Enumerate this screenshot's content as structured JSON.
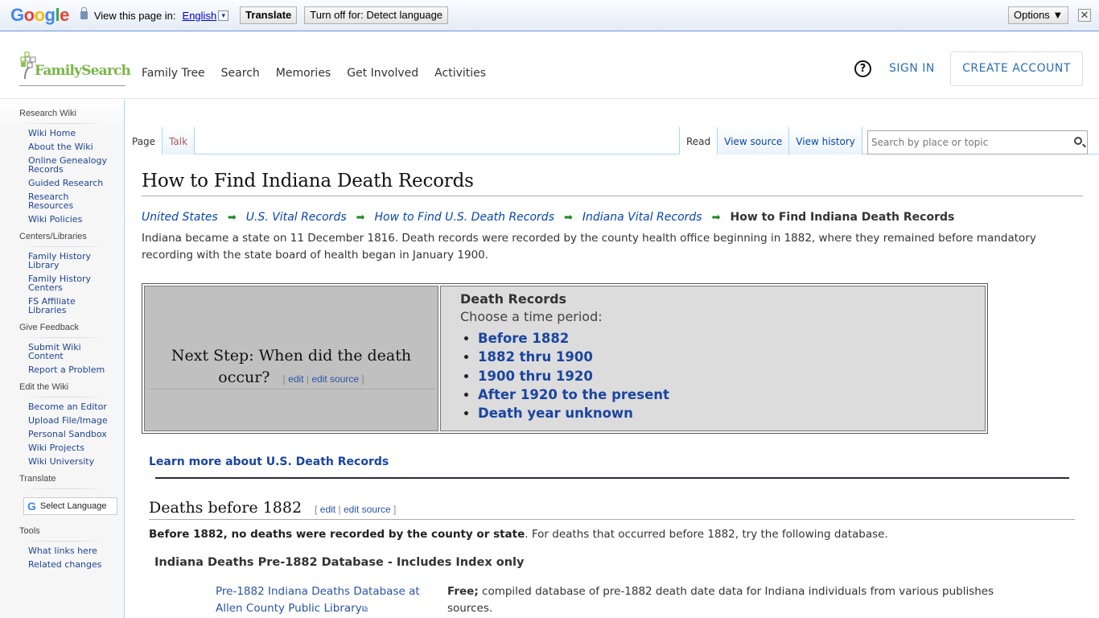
{
  "translate_bar": {
    "logo": "Google",
    "view_text": "View this page in:",
    "language": "English",
    "translate_button": "Translate",
    "turn_off_button": "Turn off for: Detect language",
    "options_button": "Options ▼",
    "close_label": "✕"
  },
  "header": {
    "logo_text": "FamilySearch",
    "nav": [
      "Family Tree",
      "Search",
      "Memories",
      "Get Involved",
      "Activities"
    ],
    "help_label": "?",
    "sign_in": "SIGN IN",
    "create_account": "CREATE ACCOUNT"
  },
  "sidebar": {
    "sections": [
      {
        "title": "Research Wiki",
        "items": [
          "Wiki Home",
          "About the Wiki",
          "Online Genealogy Records",
          "Guided Research",
          "Research Resources",
          "Wiki Policies"
        ]
      },
      {
        "title": "Centers/Libraries",
        "items": [
          "Family History Library",
          "Family History Centers",
          "FS Affiliate Libraries"
        ]
      },
      {
        "title": "Give Feedback",
        "items": [
          "Submit Wiki Content",
          "Report a Problem"
        ]
      },
      {
        "title": "Edit the Wiki",
        "items": [
          "Become an Editor",
          "Upload File/Image",
          "Personal Sandbox",
          "Wiki Projects",
          "Wiki University"
        ]
      }
    ],
    "translate_title": "Translate",
    "select_language": "Select Language",
    "tools_title": "Tools",
    "tools_items": [
      "What links here",
      "Related changes"
    ]
  },
  "tabs": {
    "left": [
      "Page",
      "Talk"
    ],
    "right": [
      "Read",
      "View source",
      "View history"
    ],
    "search_placeholder": "Search by place or topic"
  },
  "article": {
    "title": "How to Find Indiana Death Records",
    "breadcrumbs": [
      "United States",
      "U.S. Vital Records",
      "How to Find U.S. Death Records",
      "Indiana Vital Records"
    ],
    "breadcrumb_current": "How to Find Indiana Death Records",
    "intro": "Indiana became a state on 11 December 1816. Death records were recorded by the county health office beginning in 1882, where they remained before mandatory recording with the state board of health began in January 1900.",
    "next_step": "Next Step: When did the death occur?",
    "edit": "edit",
    "edit_source": "edit source",
    "death_records_title": "Death Records",
    "choose_period": "Choose a time period:",
    "periods": [
      "Before 1882",
      "1882 thru 1900",
      "1900 thru 1920",
      "After 1920 to the present",
      "Death year unknown"
    ],
    "learn_more": "Learn more about U.S. Death Records",
    "section_title": "Deaths before 1882",
    "section_bold": "Before 1882, no deaths were recorded by the county or state",
    "section_text": ". For deaths that occurred before 1882, try the following database.",
    "db_heading": "Indiana Deaths Pre-1882 Database - Includes Index only",
    "db_link": "Pre-1882 Indiana Deaths Database at Allen County Public Library",
    "db_free": "Free;",
    "db_desc": " compiled database of pre-1882 death date data for Indiana individuals from various publishes sources."
  }
}
